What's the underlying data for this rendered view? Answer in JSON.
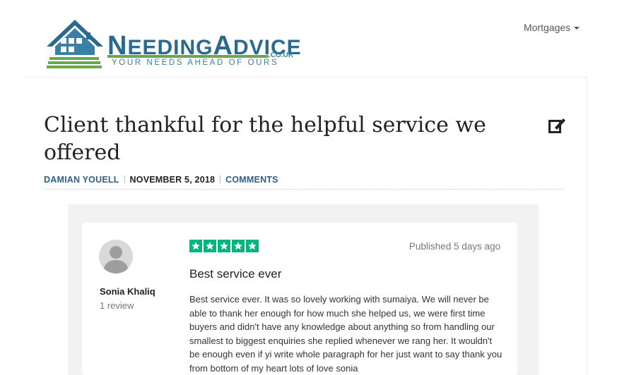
{
  "brand": {
    "name_first_letter": "N",
    "name_rest_1": "EEDING",
    "name_second_letter": "A",
    "name_rest_2": "DVICE",
    "domain": ".CO.UK",
    "tagline": "YOUR NEEDS AHEAD OF OURS",
    "colors": {
      "primary": "#2a6a8e",
      "green": "#6aa84f"
    }
  },
  "nav": {
    "mortgages_label": "Mortgages"
  },
  "article": {
    "title": "Client thankful for the helpful service we offered",
    "author": "DAMIAN YOUELL",
    "date": "NOVEMBER 5, 2018",
    "comments_label": "COMMENTS"
  },
  "review": {
    "reviewer_name": "Sonia Khaliq",
    "reviewer_count": "1 review",
    "rating": 5,
    "published": "Published 5 days ago",
    "title": "Best service ever",
    "body": "Best service ever. It was so lovely working with sumaiya. We will never be able to thank her enough for how much she helped us, we were first time buyers and didn't have any knowledge about anything so from handling our smallest to biggest enquiries she replied whenever we rang her. It wouldn't be enough even if yi write whole paragraph for her just want to say thank you from bottom of my heart lots of love sonia",
    "star_color": "#00b67a"
  }
}
